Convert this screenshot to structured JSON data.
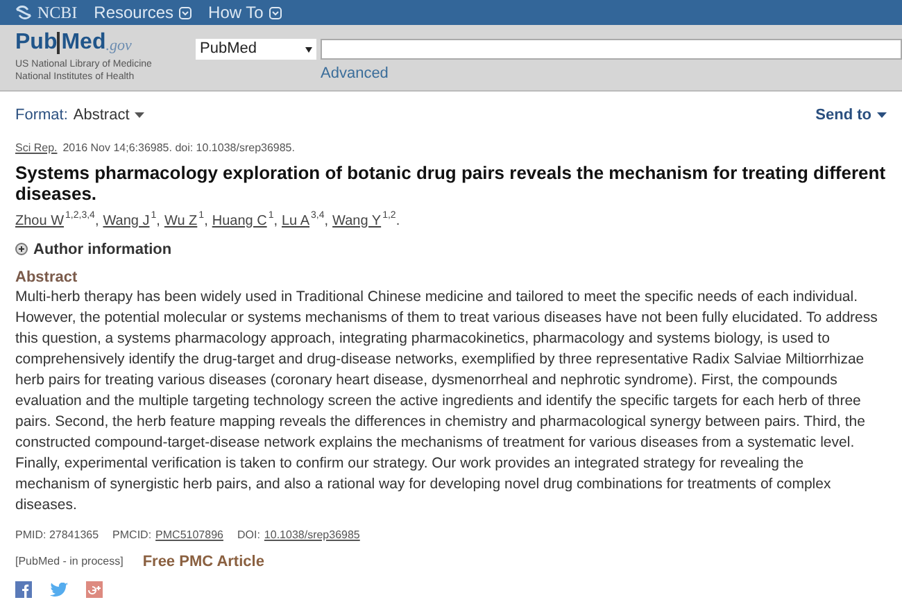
{
  "top_bar": {
    "brand": "NCBI",
    "menus": [
      {
        "label": "Resources"
      },
      {
        "label": "How To"
      }
    ]
  },
  "header": {
    "logo": {
      "part_1": "Pub",
      "part_2": "Med",
      "suffix": ".gov"
    },
    "tagline_1": "US National Library of Medicine",
    "tagline_2": "National Institutes of Health",
    "database": "PubMed",
    "advanced": "Advanced"
  },
  "toolbar": {
    "format_label": "Format:",
    "format_value": "Abstract",
    "send_to": "Send to"
  },
  "citation": {
    "journal": "Sci Rep.",
    "details": "2016 Nov 14;6:36985. doi: 10.1038/srep36985."
  },
  "title": "Systems pharmacology exploration of botanic drug pairs reveals the mechanism for treating different diseases.",
  "authors": [
    {
      "name": "Zhou W",
      "affil": "1,2,3,4",
      "sep": ","
    },
    {
      "name": "Wang J",
      "affil": "1",
      "sep": ","
    },
    {
      "name": "Wu Z",
      "affil": "1",
      "sep": ","
    },
    {
      "name": "Huang C",
      "affil": "1",
      "sep": ","
    },
    {
      "name": "Lu A",
      "affil": "3,4",
      "sep": ","
    },
    {
      "name": "Wang Y",
      "affil": "1,2",
      "sep": "."
    }
  ],
  "author_info": {
    "label": "Author information",
    "expanded": false
  },
  "abstract": {
    "heading": "Abstract",
    "text": "Multi-herb therapy has been widely used in Traditional Chinese medicine and tailored to meet the specific needs of each individual. However, the potential molecular or systems mechanisms of them to treat various diseases have not been fully elucidated. To address this question, a systems pharmacology approach, integrating pharmacokinetics, pharmacology and systems biology, is used to comprehensively identify the drug-target and drug-disease networks, exemplified by three representative Radix Salviae Miltiorrhizae herb pairs for treating various diseases (coronary heart disease, dysmenorrheal and nephrotic syndrome). First, the compounds evaluation and the multiple targeting technology screen the active ingredients and identify the specific targets for each herb of three pairs. Second, the herb feature mapping reveals the differences in chemistry and pharmacological synergy between pairs. Third, the constructed compound-target-disease network explains the mechanisms of treatment for various diseases from a systematic level. Finally, experimental verification is taken to confirm our strategy. Our work provides an integrated strategy for revealing the mechanism of synergistic herb pairs, and also a rational way for developing novel drug combinations for treatments of complex diseases."
  },
  "ids": {
    "pmid": "PMID: 27841365",
    "pmcid_label": "PMCID:",
    "pmcid": "PMC5107896",
    "doi_label": "DOI:",
    "doi": "10.1038/srep36985"
  },
  "status": "[PubMed - in process]",
  "free_article": "Free PMC Article",
  "share": [
    {
      "kind": "facebook"
    },
    {
      "kind": "twitter"
    },
    {
      "kind": "googleplus"
    }
  ]
}
